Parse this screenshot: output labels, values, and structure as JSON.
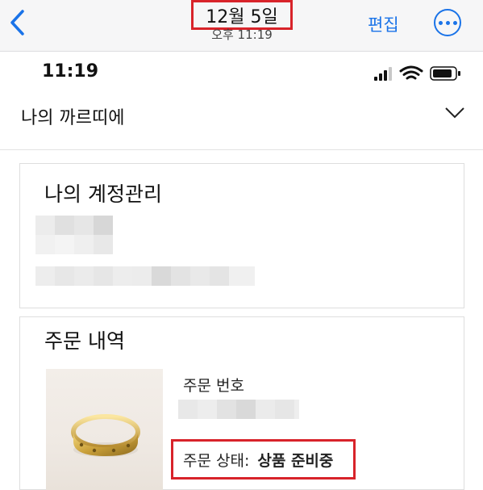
{
  "photo_viewer": {
    "date": "12월 5일",
    "time": "오후 11:19",
    "edit_label": "편집"
  },
  "phone_status": {
    "time": "11:19"
  },
  "site": {
    "menu_title": "나의 까르띠에"
  },
  "account": {
    "title": "나의 계정관리"
  },
  "order": {
    "title": "주문 내역",
    "order_number_label": "주문 번호",
    "status_label": "주문 상태:",
    "status_value": "상품 준비중"
  },
  "colors": {
    "accent_blue": "#1a73e8",
    "highlight_red": "#d8232a"
  },
  "icons": [
    "back-chevron-icon",
    "more-icon",
    "signal-icon",
    "wifi-icon",
    "battery-icon",
    "chevron-down-icon",
    "ring-image"
  ]
}
